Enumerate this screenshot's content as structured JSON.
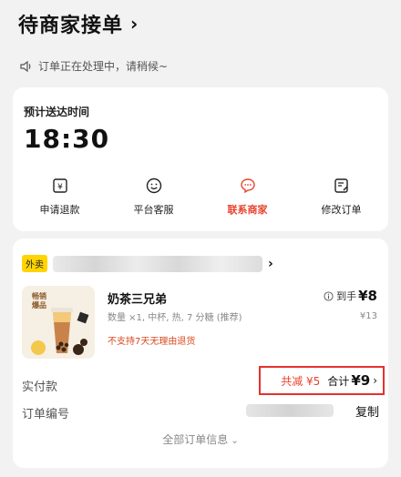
{
  "header": {
    "title": "待商家接单",
    "chevron": "›"
  },
  "notice": {
    "text": "订单正在处理中，请稍候~"
  },
  "eta": {
    "label": "预计送达时间",
    "time": "18:30"
  },
  "actions": [
    {
      "label": "申请退款",
      "icon": "refund-icon"
    },
    {
      "label": "平台客服",
      "icon": "smile-icon"
    },
    {
      "label": "联系商家",
      "icon": "chat-icon"
    },
    {
      "label": "修改订单",
      "icon": "edit-icon"
    }
  ],
  "store": {
    "tag": "外卖",
    "chevron": "›"
  },
  "product": {
    "badge": "畅销爆品",
    "name": "奶茶三兄弟",
    "spec": "数量 ×1, 中杯, 热, 7 分糖 (推荐)",
    "warning": "不支持7天无理由退货",
    "paid_label": "到手",
    "paid_amount": "¥8",
    "original_price": "¥13"
  },
  "summary": {
    "actual_label": "实付款",
    "reduction": "共减 ¥5",
    "total_label": "合计",
    "total_amount": "¥9",
    "chevron": "›",
    "order_no_label": "订单编号",
    "copy_label": "复制",
    "all_info_label": "全部订单信息"
  },
  "colors": {
    "accent": "#e8432d",
    "tag_yellow": "#ffd400",
    "highlight_border": "#e5312c"
  }
}
